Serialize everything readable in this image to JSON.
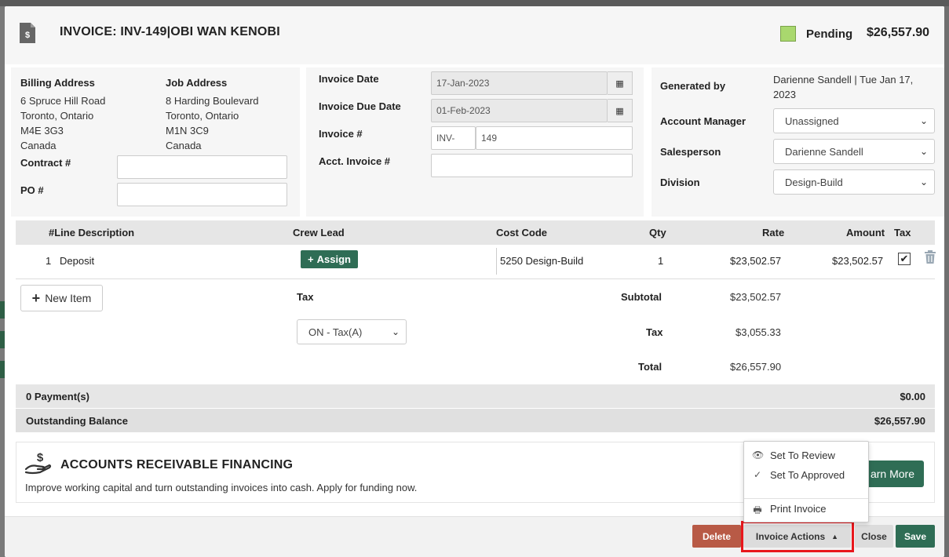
{
  "header": {
    "title": "INVOICE: INV-149|OBI WAN KENOBI",
    "status": "Pending",
    "status_color": "#a9d86e",
    "total": "$26,557.90"
  },
  "billing": {
    "billing_label": "Billing Address",
    "billing_lines": [
      "6 Spruce Hill Road",
      "Toronto, Ontario",
      "M4E 3G3",
      "Canada"
    ],
    "job_label": "Job Address",
    "job_lines": [
      "8 Harding Boulevard",
      "Toronto, Ontario",
      "M1N 3C9",
      "Canada"
    ],
    "contract_label": "Contract #",
    "contract_value": "",
    "po_label": "PO #",
    "po_value": ""
  },
  "dates": {
    "invoice_date_label": "Invoice Date",
    "invoice_date": "17-Jan-2023",
    "due_date_label": "Invoice Due Date",
    "due_date": "01-Feb-2023",
    "invoice_num_label": "Invoice #",
    "invoice_prefix": "INV-",
    "invoice_num": "149",
    "acct_invoice_label": "Acct. Invoice #",
    "acct_invoice": ""
  },
  "meta": {
    "generated_label": "Generated by",
    "generated_value": "Darienne Sandell | Tue Jan 17, 2023",
    "generated_line1": "Darienne Sandell | Tue Jan 17,",
    "generated_line2": "2023",
    "account_manager_label": "Account Manager",
    "account_manager": "Unassigned",
    "salesperson_label": "Salesperson",
    "salesperson": "Darienne Sandell",
    "division_label": "Division",
    "division": "Design-Build"
  },
  "table": {
    "headers": {
      "line": "#Line Description",
      "crew": "Crew Lead",
      "cost": "Cost Code",
      "qty": "Qty",
      "rate": "Rate",
      "amount": "Amount",
      "tax": "Tax"
    },
    "rows": [
      {
        "num": "1",
        "description": "Deposit",
        "assign_label": "Assign",
        "cost_code": "5250 Design-Build",
        "qty": "1",
        "rate": "$23,502.57",
        "amount": "$23,502.57",
        "tax_checked": "✔"
      }
    ]
  },
  "summary": {
    "new_item_label": "New Item",
    "tax_label": "Tax",
    "tax_select": "ON - Tax(A)",
    "subtotal_label": "Subtotal",
    "subtotal": "$23,502.57",
    "tax_amount_label": "Tax",
    "tax_amount": "$3,055.33",
    "total_label": "Total",
    "total": "$26,557.90"
  },
  "payments": {
    "payments_label": "0 Payment(s)",
    "payments_value": "$0.00",
    "outstanding_label": "Outstanding Balance",
    "outstanding_value": "$26,557.90"
  },
  "financing": {
    "title": "ACCOUNTS RECEIVABLE FINANCING",
    "description": "Improve working capital and turn outstanding invoices into cash. Apply for funding now.",
    "button": "arn More"
  },
  "dropdown": {
    "items": [
      {
        "icon": "eye-icon",
        "label": "Set To Review"
      },
      {
        "icon": "check-icon",
        "label": "Set To Approved"
      },
      {
        "icon": "printer-icon",
        "label": "Print Invoice"
      }
    ]
  },
  "footer": {
    "delete": "Delete",
    "invoice_actions": "Invoice Actions",
    "close": "Close",
    "save": "Save"
  },
  "colors": {
    "brand_green": "#2f6d55",
    "delete_red": "#b85a46",
    "highlight_red": "#e8171c"
  }
}
